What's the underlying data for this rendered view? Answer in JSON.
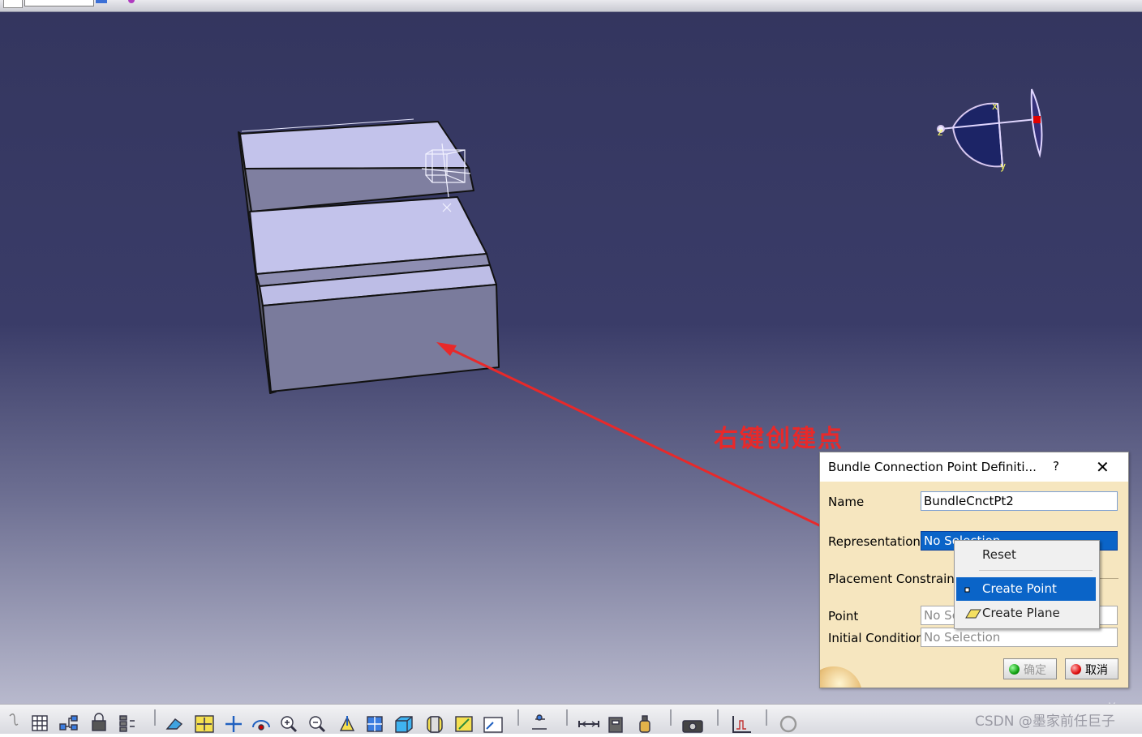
{
  "annotation": {
    "text": "右键创建点"
  },
  "dialog": {
    "title": "Bundle Connection Point Definiti...",
    "help_label": "?",
    "close_label": "✕",
    "name_label": "Name",
    "name_value": "BundleCnctPt2",
    "representation_label": "Representation",
    "representation_value": "No Selection",
    "placement_label": "Placement Constraint",
    "point_label": "Point",
    "point_value": "No Selection",
    "initial_condition_label": "Initial Condition",
    "initial_condition_value": "No Selection",
    "ok_label": "确定",
    "cancel_label": "取消"
  },
  "context_menu": {
    "items": [
      {
        "label": "Reset"
      },
      {
        "label": "Create Point",
        "highlighted": true
      },
      {
        "label": "Create Plane"
      }
    ]
  },
  "compass": {
    "labels": [
      "x",
      "y",
      "z"
    ]
  },
  "viewport": {
    "axis_glyph": "y"
  },
  "watermark": "CSDN @墨家前任巨子",
  "toolbar": {
    "icons": [
      "sketch-icon",
      "grid-icon",
      "tree-icon",
      "lock-icon",
      "hierarchy-icon",
      "fly-icon",
      "fit-all-icon",
      "pan-icon",
      "rotate-icon",
      "zoom-in-icon",
      "zoom-out-icon",
      "normal-view-icon",
      "multi-view-icon",
      "iso-view-icon",
      "shading-icon",
      "hide-show-icon",
      "swap-space-icon",
      "update-icon",
      "measure-icon",
      "inertia-icon",
      "bottle-icon",
      "camera-icon",
      "analysis-icon",
      "refresh-icon"
    ]
  },
  "colors": {
    "viewport_top": "#34365f",
    "viewport_bottom": "#b8b9cd",
    "part_face": "#c3c3eb",
    "annotation": "#e8292a",
    "dialog_bg": "#f6e6bf",
    "highlight": "#0a64c8"
  }
}
